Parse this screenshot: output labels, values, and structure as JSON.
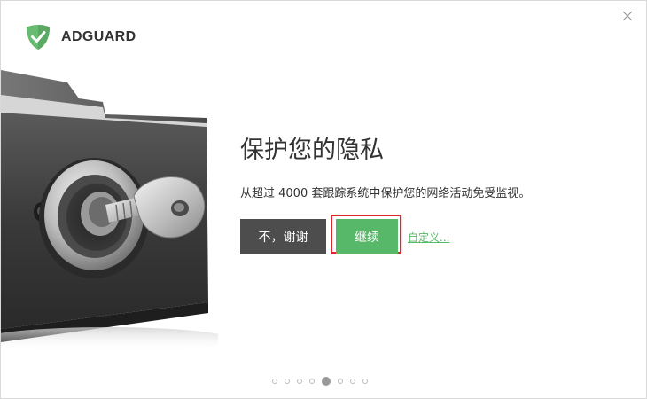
{
  "app": {
    "brand": "ADGUARD",
    "accent_color": "#57b869",
    "shield_color": "#68bc71"
  },
  "window": {
    "close_icon": "close-icon"
  },
  "page": {
    "title": "保护您的隐私",
    "description": "从超过 4000 套跟踪系统中保护您的网络活动免受监视。",
    "decline_label": "不，谢谢",
    "continue_label": "继续",
    "customize_label": "自定义..."
  },
  "pager": {
    "total": 8,
    "current": 5
  }
}
